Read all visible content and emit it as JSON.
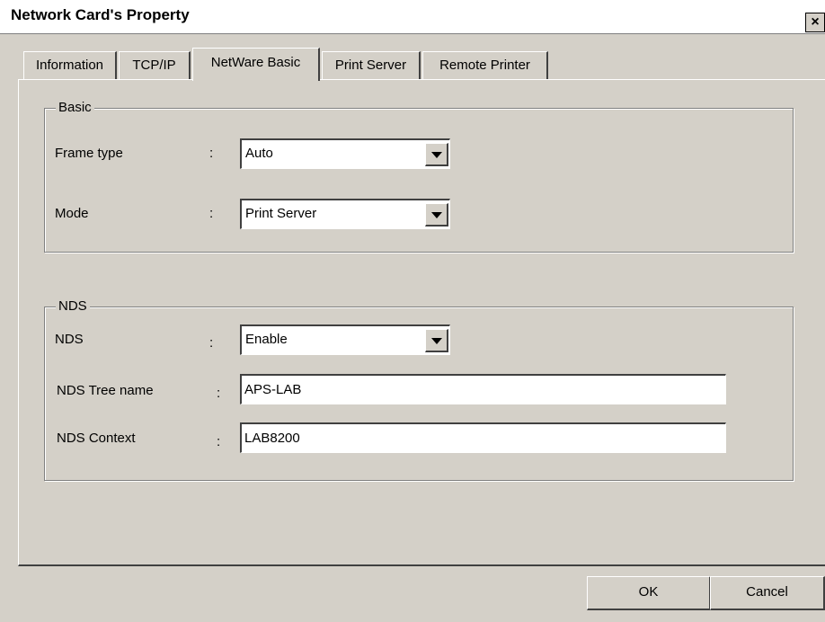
{
  "window": {
    "title": "Network Card's Property",
    "close_glyph": "×"
  },
  "tabs": [
    {
      "label": "Information",
      "active": false
    },
    {
      "label": "TCP/IP",
      "active": false
    },
    {
      "label": "NetWare Basic",
      "active": true
    },
    {
      "label": "Print Server",
      "active": false
    },
    {
      "label": "Remote Printer",
      "active": false
    }
  ],
  "basic": {
    "title": "Basic",
    "frame_type": {
      "label": "Frame type",
      "colon": ":",
      "value": "Auto"
    },
    "mode": {
      "label": "Mode",
      "colon": ":",
      "value": "Print Server"
    }
  },
  "nds": {
    "title": "NDS",
    "nds": {
      "label": "NDS",
      "colon": ":",
      "value": "Enable"
    },
    "tree_name": {
      "label": "NDS Tree name",
      "colon": ":",
      "value": "APS-LAB"
    },
    "context": {
      "label": "NDS Context",
      "colon": ":",
      "value": "LAB8200"
    }
  },
  "buttons": {
    "ok": "OK",
    "cancel": "Cancel"
  },
  "icons": {
    "close": "close-icon",
    "dropdown": "chevron-down-icon"
  },
  "colors": {
    "face": "#d4d0c8",
    "title_bg": "#ffffff"
  }
}
